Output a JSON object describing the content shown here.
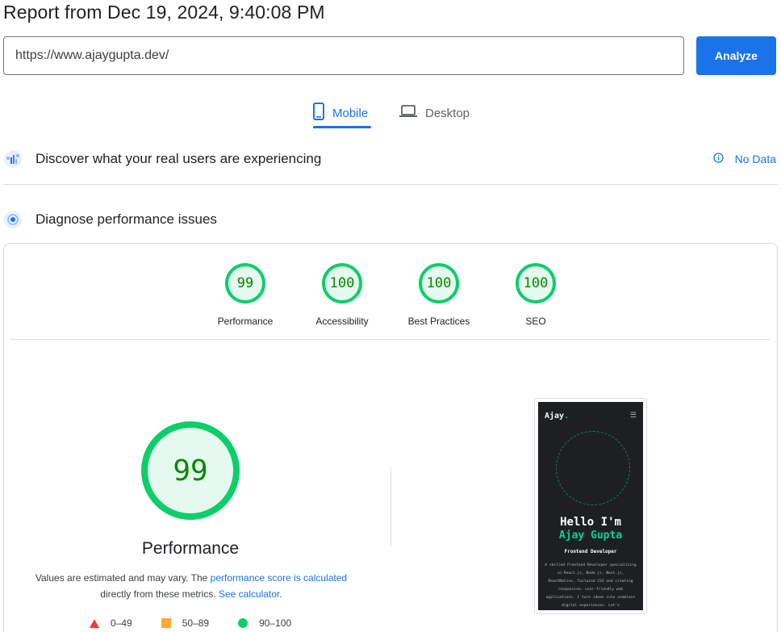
{
  "report": {
    "title": "Report from Dec 19, 2024, 9:40:08 PM"
  },
  "search": {
    "url": "https://www.ajaygupta.dev/",
    "analyze_label": "Analyze"
  },
  "tabs": [
    {
      "label": "Mobile",
      "icon": "smartphone-icon",
      "selected": true
    },
    {
      "label": "Desktop",
      "icon": "laptop-icon",
      "selected": false
    }
  ],
  "sections": {
    "crux": {
      "title": "Discover what your real users are experiencing",
      "status": "No Data"
    },
    "diagnose": {
      "title": "Diagnose performance issues"
    }
  },
  "scores": [
    {
      "label": "Performance",
      "value": "99"
    },
    {
      "label": "Accessibility",
      "value": "100"
    },
    {
      "label": "Best Practices",
      "value": "100"
    },
    {
      "label": "SEO",
      "value": "100"
    }
  ],
  "performance": {
    "score": "99",
    "title": "Performance",
    "desc_prefix": "Values are estimated and may vary. The ",
    "desc_link1": "performance score is calculated",
    "desc_middle": " directly from these metrics. ",
    "desc_link2": "See calculator",
    "desc_suffix": "."
  },
  "legend": [
    {
      "range": "0–49",
      "color": "#ff3333",
      "shape": "triangle"
    },
    {
      "range": "50–89",
      "color": "#ffaa33",
      "shape": "square"
    },
    {
      "range": "90–100",
      "color": "#0cce6b",
      "shape": "circle"
    }
  ],
  "screenshot": {
    "logo": "Ajay",
    "logo_dot": ".",
    "menu": "☰",
    "hello": "Hello I'm",
    "name": "Ajay Gupta",
    "role": "Frontend Developer",
    "bio": "A skilled Frontend Developer specializing in React.js, Node.js, Next.js, ReactNative, Tailwind CSS and creating responsive, user-friendly web applications. I turn ideas into seamless digital experiences. Let's"
  },
  "colors": {
    "accent": "#1a73e8",
    "pass": "#0cce6b",
    "pass_text": "#008800",
    "average": "#ffaa33",
    "fail": "#ff3333"
  }
}
